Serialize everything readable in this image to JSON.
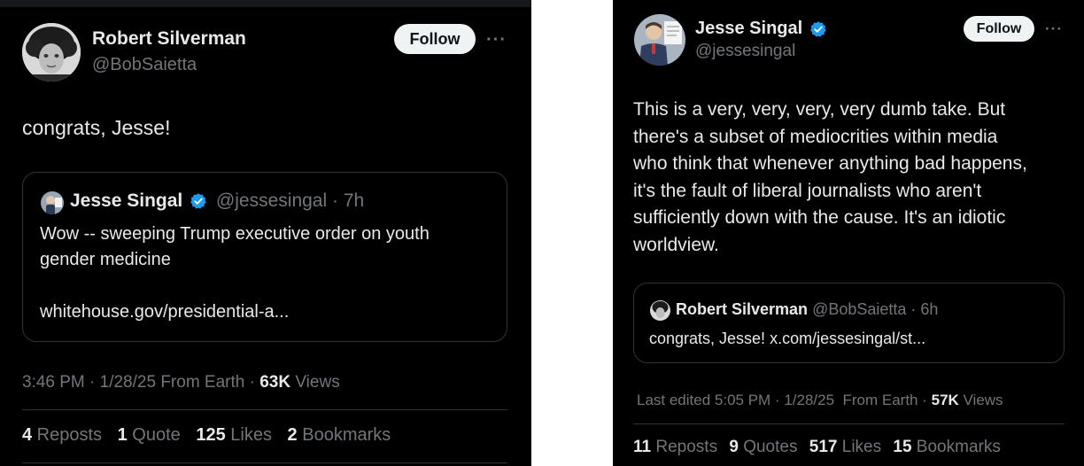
{
  "left": {
    "author_name": "Robert Silverman",
    "author_handle": "@BobSaietta",
    "follow_label": "Follow",
    "more_label": "···",
    "text": "congrats, Jesse!",
    "quote": {
      "author_name": "Jesse Singal",
      "author_handle": "@jessesingal",
      "time": "· 7h",
      "line1": "Wow -- sweeping Trump executive order on youth",
      "line2": "gender medicine",
      "link": "whitehouse.gov/presidential-a..."
    },
    "meta": {
      "timestamp": "3:46 PM · 1/28/25 From Earth · ",
      "views_count": "63K",
      "views_label": " Views"
    },
    "stats": {
      "reposts_count": "4",
      "reposts_label": " Reposts",
      "quotes_count": "1",
      "quotes_label": " Quote",
      "likes_count": "125",
      "likes_label": " Likes",
      "bookmarks_count": "2",
      "bookmarks_label": " Bookmarks"
    }
  },
  "right": {
    "author_name": "Jesse Singal",
    "author_handle": "@jessesingal",
    "follow_label": "Follow",
    "more_label": "···",
    "text_lines": [
      "This is a very, very, very, very dumb take. But",
      "there's a subset of mediocrities within media",
      "who think that whenever anything bad happens,",
      "it's the fault of liberal journalists who aren't",
      "sufficiently down with the cause. It's an idiotic",
      "worldview."
    ],
    "quote": {
      "author_name": "Robert Silverman",
      "author_handle": "@BobSaietta",
      "time": "· 6h",
      "text": "congrats, Jesse! x.com/jessesingal/st..."
    },
    "meta": {
      "timestamp": "Last edited 5:05 PM · 1/28/25  From Earth · ",
      "views_count": "57K",
      "views_label": " Views"
    },
    "stats": {
      "reposts_count": "11",
      "reposts_label": " Reposts",
      "quotes_count": "9",
      "quotes_label": " Quotes",
      "likes_count": "517",
      "likes_label": " Likes",
      "bookmarks_count": "15",
      "bookmarks_label": " Bookmarks"
    }
  },
  "colors": {
    "background": "#000000",
    "text": "#e7e9ea",
    "muted": "#71767b",
    "verified": "#1d9bf0",
    "border": "#2f3336",
    "follow_bg": "#eff3f4"
  }
}
